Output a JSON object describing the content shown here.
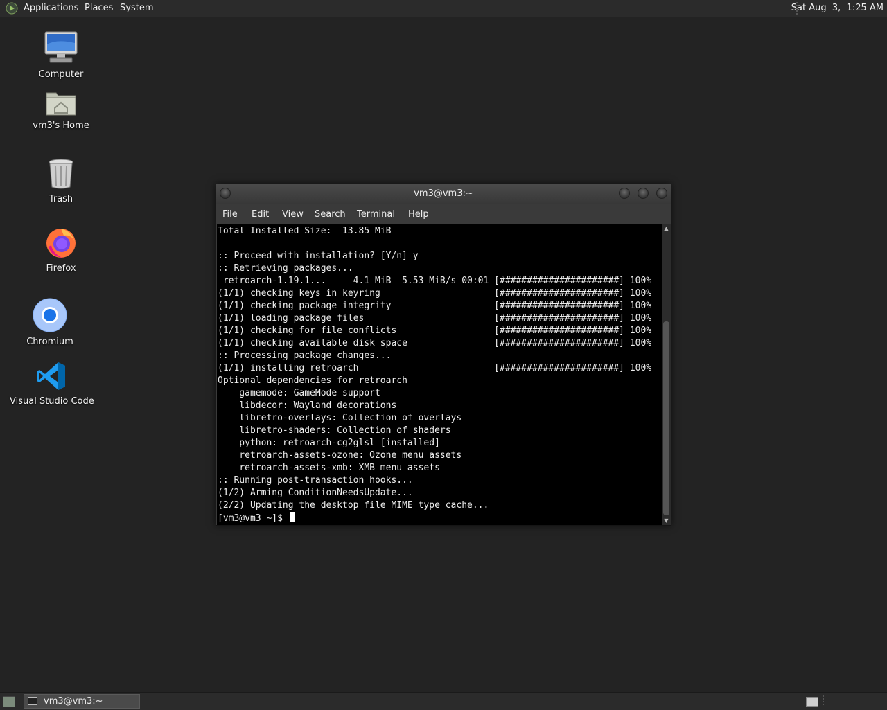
{
  "top_panel": {
    "menus": [
      "Applications",
      "Places",
      "System"
    ],
    "clock": "Sat Aug  3,  1:25 AM"
  },
  "desktop": {
    "icons": [
      {
        "label": "Computer",
        "icon": "computer-icon"
      },
      {
        "label": "vm3's Home",
        "icon": "home-folder-icon"
      },
      {
        "label": "Trash",
        "icon": "trash-icon"
      },
      {
        "label": "Firefox",
        "icon": "firefox-icon"
      },
      {
        "label": "Chromium",
        "icon": "chromium-icon"
      },
      {
        "label": "Visual Studio Code",
        "icon": "vscode-icon"
      }
    ]
  },
  "terminal": {
    "title": "vm3@vm3:~",
    "menu": [
      "File",
      "Edit",
      "View",
      "Search",
      "Terminal",
      "Help"
    ],
    "lines": [
      "Total Installed Size:  13.85 MiB",
      "",
      ":: Proceed with installation? [Y/n] y",
      ":: Retrieving packages...",
      " retroarch-1.19.1...     4.1 MiB  5.53 MiB/s 00:01 [######################] 100%",
      "(1/1) checking keys in keyring                     [######################] 100%",
      "(1/1) checking package integrity                   [######################] 100%",
      "(1/1) loading package files                        [######################] 100%",
      "(1/1) checking for file conflicts                  [######################] 100%",
      "(1/1) checking available disk space                [######################] 100%",
      ":: Processing package changes...",
      "(1/1) installing retroarch                         [######################] 100%",
      "Optional dependencies for retroarch",
      "    gamemode: GameMode support",
      "    libdecor: Wayland decorations",
      "    libretro-overlays: Collection of overlays",
      "    libretro-shaders: Collection of shaders",
      "    python: retroarch-cg2glsl [installed]",
      "    retroarch-assets-ozone: Ozone menu assets",
      "    retroarch-assets-xmb: XMB menu assets",
      ":: Running post-transaction hooks...",
      "(1/2) Arming ConditionNeedsUpdate...",
      "(2/2) Updating the desktop file MIME type cache..."
    ],
    "prompt": "[vm3@vm3 ~]$ "
  },
  "taskbar": {
    "task_label": "vm3@vm3:~"
  }
}
